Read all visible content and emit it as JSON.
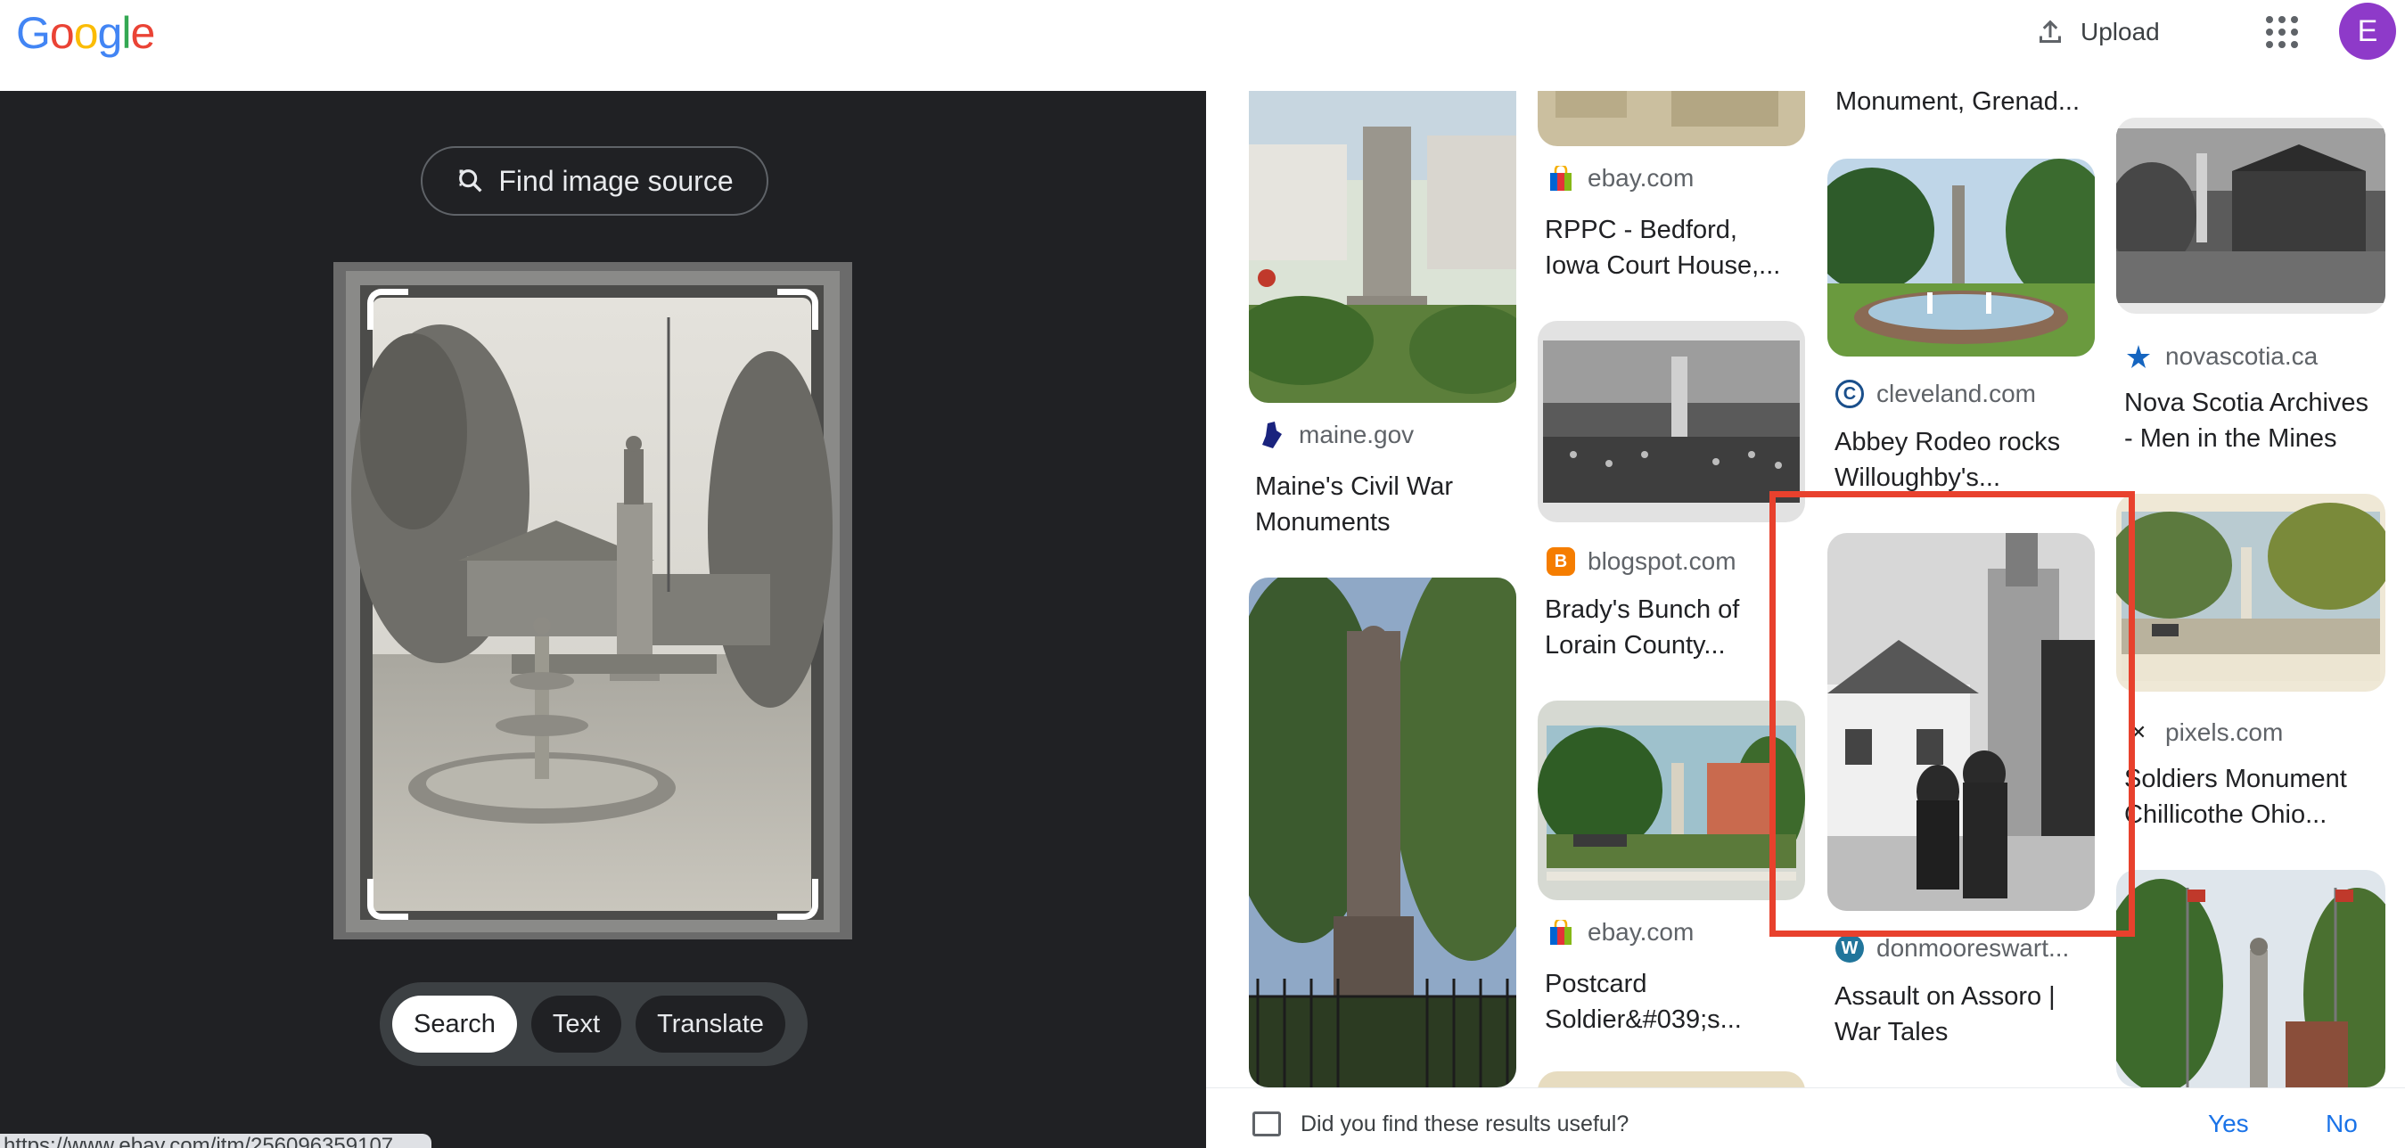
{
  "header": {
    "logo_letters": [
      "G",
      "o",
      "o",
      "g",
      "l",
      "e"
    ],
    "upload_label": "Upload",
    "avatar_initial": "E",
    "avatar_color": "#8e3ac9"
  },
  "left_panel": {
    "find_source_label": "Find image source",
    "modes": [
      {
        "label": "Search",
        "active": true
      },
      {
        "label": "Text",
        "active": false
      },
      {
        "label": "Translate",
        "active": false
      }
    ],
    "status_url": "https://www.ebay.com/itm/256096359107"
  },
  "results": [
    {
      "id": "r1",
      "source": "maine.gov",
      "title_lines": [
        "Maine's Civil War",
        "Monuments"
      ],
      "favicon": "maine-icon"
    },
    {
      "id": "r2",
      "source": "ebay.com",
      "title_lines": [
        "RPPC - Bedford,",
        "Iowa Court House,..."
      ],
      "favicon": "ebay-icon"
    },
    {
      "id": "r3",
      "source": "blogspot.com",
      "title_lines": [
        "Brady's Bunch of",
        "Lorain County..."
      ],
      "favicon": "blogger-icon"
    },
    {
      "id": "r4",
      "source": "ebay.com",
      "title_lines": [
        "Postcard",
        "Soldier&#039;s..."
      ],
      "favicon": "ebay-icon"
    },
    {
      "id": "r5",
      "source": "",
      "title_lines": [
        "Monument, Grenad..."
      ],
      "favicon": ""
    },
    {
      "id": "r6",
      "source": "cleveland.com",
      "title_lines": [
        "Abbey Rodeo rocks",
        "Willoughby's..."
      ],
      "favicon": "cleveland-icon"
    },
    {
      "id": "r7",
      "source": "donmooreswart...",
      "title_lines": [
        "Assault on Assoro |",
        "War Tales"
      ],
      "favicon": "wordpress-icon"
    },
    {
      "id": "r8",
      "source": "novascotia.ca",
      "title_lines": [
        "Nova Scotia Archives",
        "- Men in the Mines"
      ],
      "favicon": "novascotia-icon"
    },
    {
      "id": "r9",
      "source": "pixels.com",
      "title_lines": [
        "Soldiers Monument",
        "Chillicothe Ohio..."
      ],
      "favicon": "pixels-icon"
    }
  ],
  "feedback": {
    "question": "Did you find these results useful?",
    "yes_label": "Yes",
    "no_label": "No"
  },
  "colors": {
    "highlight_box": "#e8412d",
    "dark_panel": "#202124",
    "link_blue": "#1a73e8"
  }
}
